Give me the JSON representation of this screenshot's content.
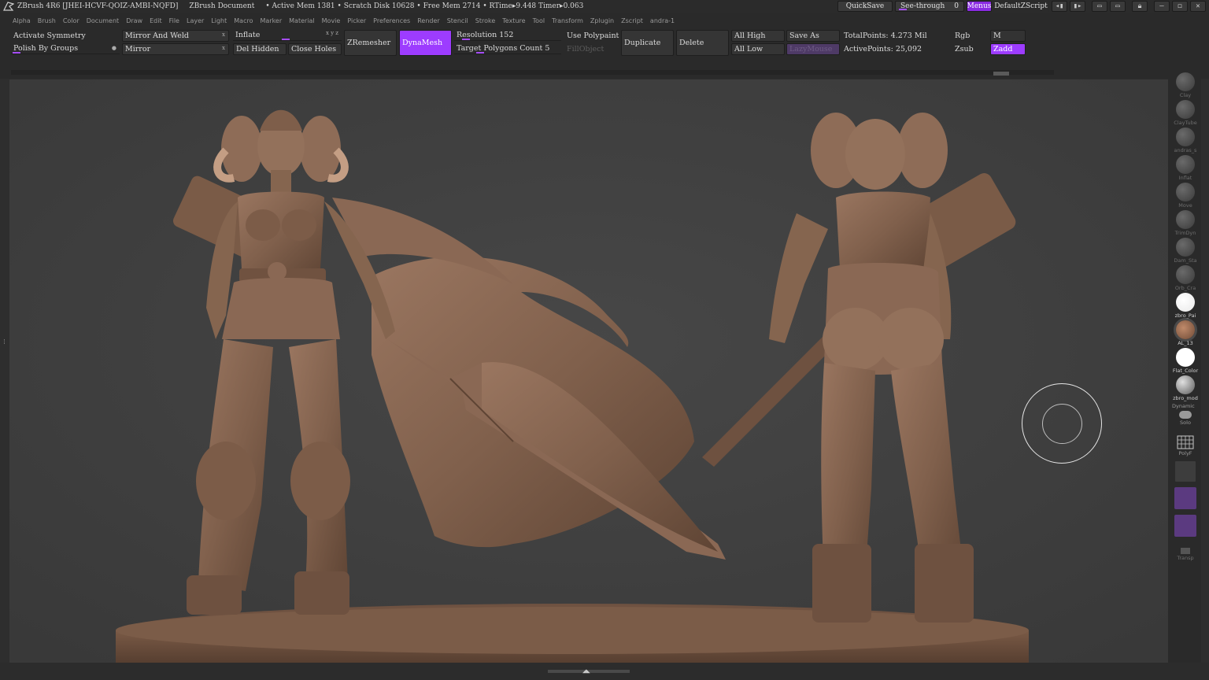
{
  "titlebar": {
    "app_title": "ZBrush 4R6 [JHEI-HCVF-QOIZ-AMBI-NQFD]",
    "document": "ZBrush Document",
    "stats": "• Active Mem 1381 • Scratch Disk 10628 • Free Mem 2714 • RTime▸9.448 Timer▸0.063",
    "quicksave": "QuickSave",
    "seethrough": "See-through",
    "seethrough_value": "0",
    "menus": "Menus",
    "script": "DefaultZScript"
  },
  "menubar": [
    "Alpha",
    "Brush",
    "Color",
    "Document",
    "Draw",
    "Edit",
    "File",
    "Layer",
    "Light",
    "Macro",
    "Marker",
    "Material",
    "Movie",
    "Picker",
    "Preferences",
    "Render",
    "Stencil",
    "Stroke",
    "Texture",
    "Tool",
    "Transform",
    "Zplugin",
    "Zscript",
    "andra-1"
  ],
  "shelf": {
    "activate_symmetry": "Activate Symmetry",
    "polish_by_groups": "Polish By Groups",
    "mirror_and_weld": "Mirror And Weld",
    "mirror": "Mirror",
    "inflate": "Inflate",
    "inflate_xyz": "x y z",
    "del_hidden": "Del Hidden",
    "close_holes": "Close Holes",
    "zremesher": "ZRemesher",
    "dynamesh": "DynaMesh",
    "resolution": "Resolution 152",
    "target_polygons": "Target Polygons Count 5",
    "use_polypaint": "Use Polypaint",
    "fillobject": "FillObject",
    "duplicate": "Duplicate",
    "delete": "Delete",
    "all_high": "All High",
    "all_low": "All Low",
    "save_as": "Save As",
    "lazymouse": "LazyMouse",
    "total_points": "TotalPoints: 4.273 Mil",
    "active_points": "ActivePoints: 25,092",
    "rgb": "Rgb",
    "m": "M",
    "zsub": "Zsub",
    "zadd": "Zadd"
  },
  "right_shelf": [
    {
      "label": "Clay",
      "icon": "clay-brush-icon"
    },
    {
      "label": "ClayTube",
      "icon": "claytube-brush-icon"
    },
    {
      "label": "andras_s",
      "icon": "custom-brush-icon"
    },
    {
      "label": "Inflat",
      "icon": "inflate-brush-icon"
    },
    {
      "label": "Move",
      "icon": "move-brush-icon"
    },
    {
      "label": "TrimDyn",
      "icon": "trimdynamic-brush-icon"
    },
    {
      "label": "Dam_Sta",
      "icon": "damstandard-brush-icon"
    },
    {
      "label": "Orb_Cra",
      "icon": "orb-cracks-brush-icon"
    },
    {
      "label": "zbro_Pai",
      "icon": "paint-material-icon"
    },
    {
      "label": "AL_13",
      "icon": "alpha-material-icon"
    },
    {
      "label": "Flat_Color",
      "icon": "flat-color-icon"
    },
    {
      "label": "zbro_mod",
      "icon": "zbro-material-icon"
    }
  ],
  "right_shelf_extra": {
    "dynamic": "Dynamic",
    "solo": "Solo",
    "polyf": "PolyF",
    "transp": "Transp"
  },
  "colors": {
    "accent": "#9d3cff",
    "viewport_bg": "#3f3f3f",
    "clay": "#8a6650"
  }
}
